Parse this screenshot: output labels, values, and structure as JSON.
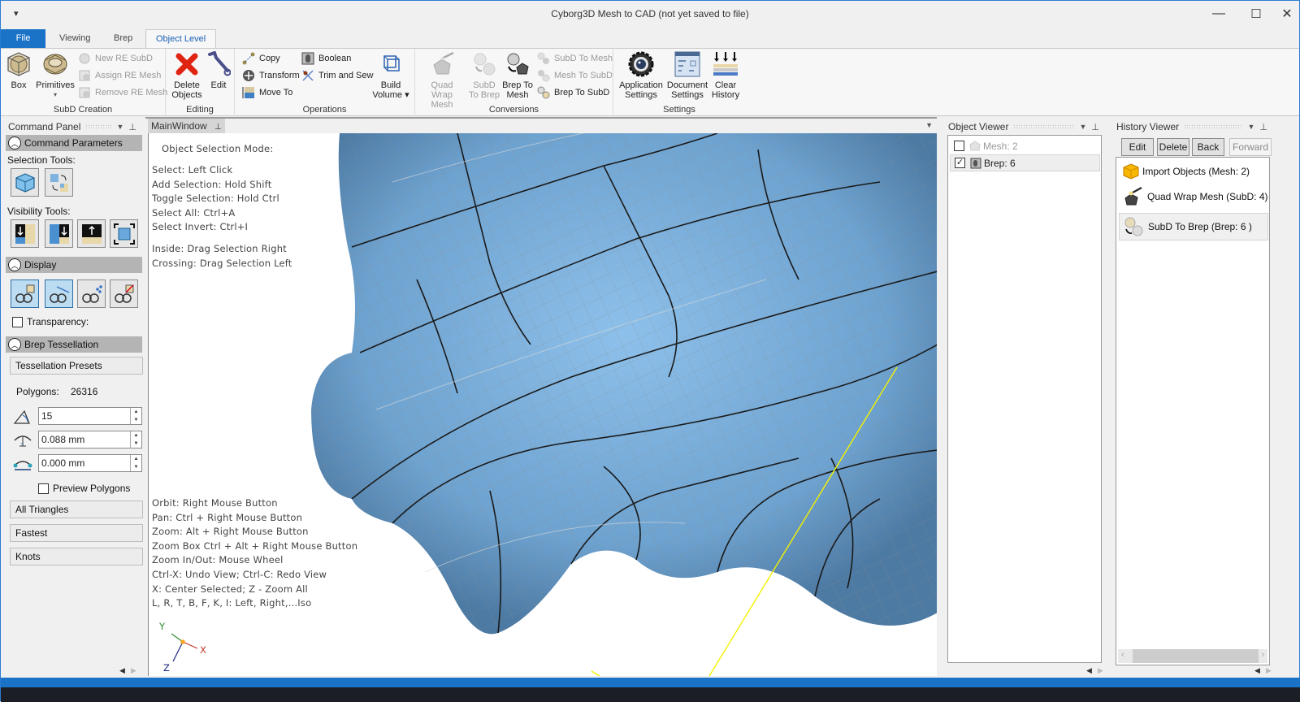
{
  "window": {
    "title": "Cyborg3D Mesh to CAD  (not yet saved to file)",
    "qat_icon": "customize-quick-access-icon",
    "controls": {
      "minimize": "—",
      "maximize": "☐",
      "close": "✕"
    }
  },
  "ribbon": {
    "tabs": [
      {
        "label": "File",
        "active": false
      },
      {
        "label": "Viewing",
        "active": false
      },
      {
        "label": "Brep",
        "active": false
      },
      {
        "label": "Object Level",
        "active": true
      }
    ],
    "groups": {
      "subd_creation": {
        "label": "SubD Creation",
        "box": "Box",
        "primitives": "Primitives",
        "new_re_subd": "New RE SubD",
        "assign_re_mesh": "Assign RE Mesh",
        "remove_re_mesh": "Remove RE Mesh"
      },
      "editing": {
        "label": "Editing",
        "delete_line1": "Delete",
        "delete_line2": "Objects",
        "edit": "Edit"
      },
      "operations": {
        "label": "Operations",
        "copy": "Copy",
        "transform": "Transform",
        "move_to": "Move To",
        "boolean": "Boolean",
        "trim_and_sew": "Trim and Sew",
        "build_line1": "Build",
        "build_line2": "Volume ▾"
      },
      "conversions": {
        "label": "Conversions",
        "quad_line1": "Quad",
        "quad_line2": "Wrap Mesh",
        "subd_brep_line1": "SubD",
        "subd_brep_line2": "To Brep",
        "brep_mesh_line1": "Brep To",
        "brep_mesh_line2": "Mesh",
        "subd_to_mesh": "SubD To Mesh",
        "mesh_to_subd": "Mesh To SubD",
        "brep_to_subd": "Brep To SubD"
      },
      "settings": {
        "label": "Settings",
        "app_line1": "Application",
        "app_line2": "Settings",
        "doc_line1": "Document",
        "doc_line2": "Settings",
        "clear_line1": "Clear",
        "clear_line2": "History"
      }
    }
  },
  "command_panel": {
    "title": "Command Panel",
    "sections": {
      "command_parameters": "Command Parameters",
      "selection_tools": "Selection Tools:",
      "visibility_tools": "Visibility Tools:",
      "display": "Display",
      "transparency": "Transparency:",
      "brep_tessellation": "Brep Tessellation"
    },
    "transparency_checked": false,
    "tessellation": {
      "presets_label": "Tessellation Presets",
      "polygons_label": "Polygons:",
      "polygons_value": "26316",
      "angle_value": "15",
      "distance_value": "0.088 mm",
      "min_edge_value": "0.000 mm",
      "preview_polygons": "Preview Polygons",
      "preview_checked": false,
      "presets": [
        "All Triangles",
        "Fastest",
        "Knots"
      ]
    }
  },
  "viewport": {
    "tab_label": "MainWindow",
    "selection_mode_title": "Object Selection Mode:",
    "selection_help": [
      "Select: Left Click",
      "Add Selection: Hold Shift",
      "Toggle Selection: Hold Ctrl",
      "Select All: Ctrl+A",
      "Select Invert: Ctrl+I"
    ],
    "drag_help": [
      "Inside: Drag Selection Right",
      "Crossing: Drag Selection Left"
    ],
    "nav_help": [
      "Orbit: Right Mouse Button",
      "Pan: Ctrl + Right Mouse Button",
      "Zoom: Alt + Right Mouse Button",
      "Zoom Box Ctrl + Alt + Right Mouse Button",
      "Zoom In/Out: Mouse Wheel",
      "Ctrl-X: Undo View; Ctrl-C: Redo View",
      "X: Center Selected; Z - Zoom All",
      "L, R, T, B, F, K, I: Left, Right,...Iso"
    ],
    "axes": {
      "x": "X",
      "y": "Y",
      "z": "Z"
    },
    "colors": {
      "surface": "#7fb2de",
      "x_axis": "#c0392b",
      "y_axis": "#2e8b2e",
      "z_axis": "#1a237e",
      "guide_line": "#f2f200"
    }
  },
  "object_viewer": {
    "title": "Object Viewer",
    "items": [
      {
        "label": "Mesh: 2",
        "checked": false,
        "dimmed": true
      },
      {
        "label": "Brep: 6",
        "checked": true,
        "dimmed": false
      }
    ]
  },
  "history_viewer": {
    "title": "History Viewer",
    "buttons": {
      "edit": "Edit",
      "delete": "Delete",
      "back": "Back",
      "forward": "Forward"
    },
    "items": [
      {
        "label": "Import Objects (Mesh: 2)"
      },
      {
        "label": "Quad Wrap Mesh (SubD: 4)"
      },
      {
        "label": "SubD To Brep (Brep: 6 )"
      }
    ]
  }
}
